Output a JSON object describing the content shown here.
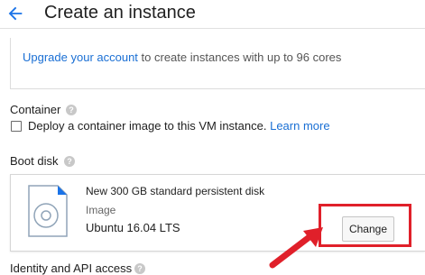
{
  "header": {
    "title": "Create an instance",
    "back_icon": "arrow-back-icon",
    "accent_color": "#1a73e8"
  },
  "upgrade": {
    "link_text": "Upgrade your account",
    "rest_text": " to create instances with up to 96 cores"
  },
  "container": {
    "label": "Container",
    "description": "Deploy a container image to this VM instance.",
    "learn_more": "Learn more",
    "checked": false
  },
  "boot_disk": {
    "label": "Boot disk",
    "disk_description": "New 300 GB standard persistent disk",
    "image_label": "Image",
    "os": "Ubuntu 16.04 LTS",
    "change_label": "Change",
    "disk_icon": "disk-image-icon"
  },
  "annotation": {
    "highlight_color": "#e0202a"
  },
  "next_section": {
    "label": "Identity and API access"
  }
}
